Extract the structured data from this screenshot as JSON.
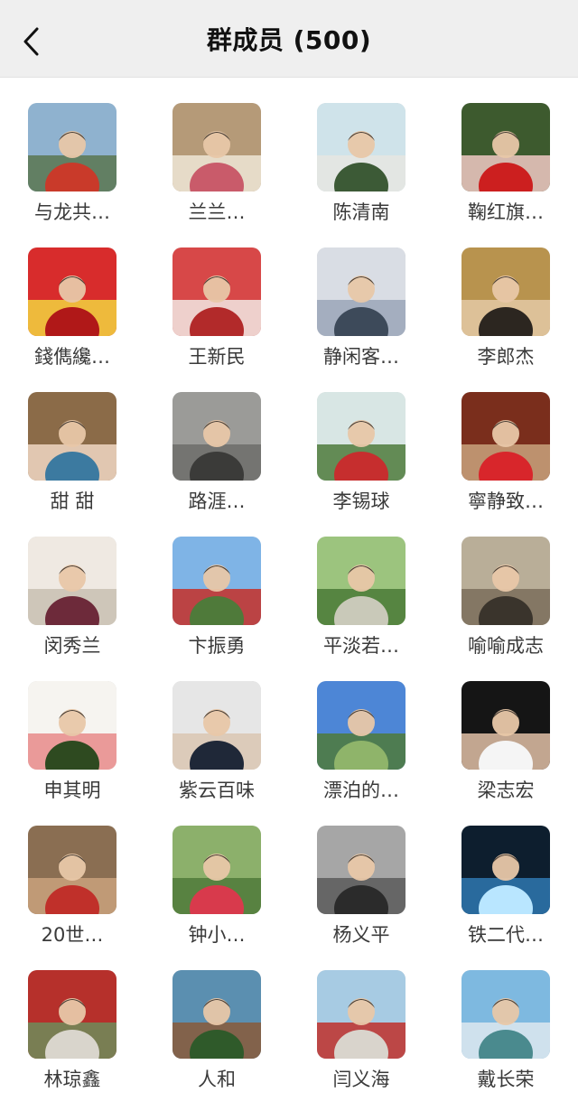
{
  "header": {
    "title": "群成员 (500)",
    "back_icon": "chevron-left-icon"
  },
  "members": [
    {
      "name": "与龙共…",
      "colors": [
        "#8fb2cf",
        "#5a7650",
        "#c93a2a"
      ]
    },
    {
      "name": "兰兰…",
      "colors": [
        "#b59a78",
        "#efe6d6",
        "#c95b6a"
      ]
    },
    {
      "name": "陈清南",
      "colors": [
        "#cfe3ea",
        "#e6e6e2",
        "#3c5a36"
      ]
    },
    {
      "name": "鞠红旗…",
      "colors": [
        "#3d5a2e",
        "#f0c9c3",
        "#cc1f1f"
      ]
    },
    {
      "name": "錢儁纔…",
      "colors": [
        "#d82c2c",
        "#f2d440",
        "#b01818"
      ]
    },
    {
      "name": "王新民",
      "colors": [
        "#d74848",
        "#f2e9e4",
        "#b22a2a"
      ]
    },
    {
      "name": "静闲客…",
      "colors": [
        "#d9dde4",
        "#9aa6b8",
        "#3d4a5a"
      ]
    },
    {
      "name": "李郎杰",
      "colors": [
        "#b8934e",
        "#e3c9a6",
        "#2c2620"
      ]
    },
    {
      "name": "甜 甜",
      "colors": [
        "#8b6b48",
        "#f0d7c4",
        "#3c7aa0"
      ]
    },
    {
      "name": "路涯…",
      "colors": [
        "#9b9b98",
        "#6d6d6a",
        "#3b3b39"
      ]
    },
    {
      "name": "李锡球",
      "colors": [
        "#d8e6e4",
        "#4f7a3c",
        "#c62e2e"
      ]
    },
    {
      "name": "寧静致…",
      "colors": [
        "#7a2e1c",
        "#c9a27c",
        "#d8262b"
      ]
    },
    {
      "name": "闵秀兰",
      "colors": [
        "#efe9e2",
        "#c8bfb2",
        "#6d2a3a"
      ]
    },
    {
      "name": "卞振勇",
      "colors": [
        "#7fb4e6",
        "#c62f27",
        "#4f7a3a"
      ]
    },
    {
      "name": "平淡若…",
      "colors": [
        "#9cc47e",
        "#4a7a36",
        "#c9c9b9"
      ]
    },
    {
      "name": "喻喻成志",
      "colors": [
        "#b9ae98",
        "#7a6d5a",
        "#3a342c"
      ]
    },
    {
      "name": "申其明",
      "colors": [
        "#f6f4f0",
        "#e88a8a",
        "#2e4a20"
      ]
    },
    {
      "name": "紫云百味",
      "colors": [
        "#e6e6e6",
        "#d9c6b2",
        "#1f2838"
      ]
    },
    {
      "name": "漂泊的…",
      "colors": [
        "#4d86d6",
        "#4f7a3a",
        "#8fb46a"
      ]
    },
    {
      "name": "梁志宏",
      "colors": [
        "#151515",
        "#e0bfa6",
        "#f5f5f5"
      ]
    },
    {
      "name": "20世…",
      "colors": [
        "#8a6e52",
        "#c9a27c",
        "#c0302a"
      ]
    },
    {
      "name": "钟小…",
      "colors": [
        "#8cb06b",
        "#4f7a3a",
        "#d83a4c"
      ]
    },
    {
      "name": "杨义平",
      "colors": [
        "#a6a6a6",
        "#5a5a5a",
        "#2b2b2b"
      ]
    },
    {
      "name": "铁二代…",
      "colors": [
        "#0d1e2e",
        "#2f78b0",
        "#b9e6ff"
      ]
    },
    {
      "name": "林琼鑫",
      "colors": [
        "#b6302b",
        "#6f8c5a",
        "#d9d5cc"
      ]
    },
    {
      "name": "人和",
      "colors": [
        "#5b8fb0",
        "#8a5a3a",
        "#2f5a2a"
      ]
    },
    {
      "name": "闫义海",
      "colors": [
        "#a7cbe3",
        "#c0302a",
        "#d9d4cc"
      ]
    },
    {
      "name": "戴长荣",
      "colors": [
        "#7eb9e0",
        "#dde8ee",
        "#4a8a8e"
      ]
    }
  ]
}
